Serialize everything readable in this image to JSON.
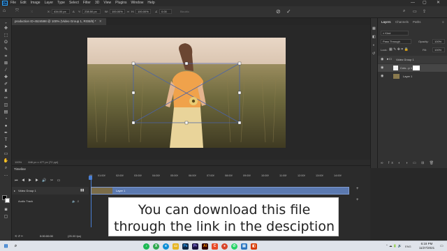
{
  "app": {
    "menu": [
      "File",
      "Edit",
      "Image",
      "Layer",
      "Type",
      "Select",
      "Filter",
      "3D",
      "View",
      "Plugins",
      "Window",
      "Help"
    ],
    "window_controls": [
      "—",
      "▢",
      "✕"
    ]
  },
  "options_bar": {
    "x_label": "X:",
    "x_value": "434.00 px",
    "y_label": "Y:",
    "y_value": "238.50 px",
    "w_label": "W:",
    "w_value": "100.00%",
    "h_label": "H:",
    "h_value": "100.00%",
    "angle_label": "∠",
    "angle_value": "0.00",
    "interp": "Bicubic",
    "cancel": "⊘",
    "commit": "✓"
  },
  "document": {
    "tab_title": "production ID-4524598 @ 100% (Video Group 1, RGB/8) *",
    "zoom": "100%",
    "dims": "846 px x 477 px (72 ppi)"
  },
  "layers_panel": {
    "tabs": [
      "Layers",
      "Channels",
      "Paths"
    ],
    "kind": "Kind",
    "blend_mode": "Pass Through",
    "opacity_label": "Opacity:",
    "opacity_value": "100%",
    "lock_label": "Lock:",
    "fill_label": "Fill:",
    "fill_value": "100%",
    "layers": [
      {
        "name": "Video Group 1"
      },
      {
        "name": "Colo...p 1"
      },
      {
        "name": "Layer 1"
      }
    ]
  },
  "timeline": {
    "title": "Timeline",
    "ruler": [
      "01:00f",
      "02:00f",
      "03:00f",
      "04:00f",
      "05:00f",
      "06:00f",
      "07:00f",
      "08:00f",
      "09:00f",
      "10:00f",
      "11:00f",
      "12:00f",
      "13:00f",
      "14:00f"
    ],
    "ruler_start": "00",
    "track_name": "Video Group 1",
    "clip_name": "Layer 1",
    "audio_track": "Audio Track",
    "timecode": "0:00:00:00",
    "fps": "(25.00 fps)"
  },
  "caption": {
    "line1": "You can download this file",
    "line2": "through the link in the desciption"
  },
  "taskbar": {
    "time": "6:18 PM",
    "date": "11/27/2021",
    "lang": "ENG"
  }
}
